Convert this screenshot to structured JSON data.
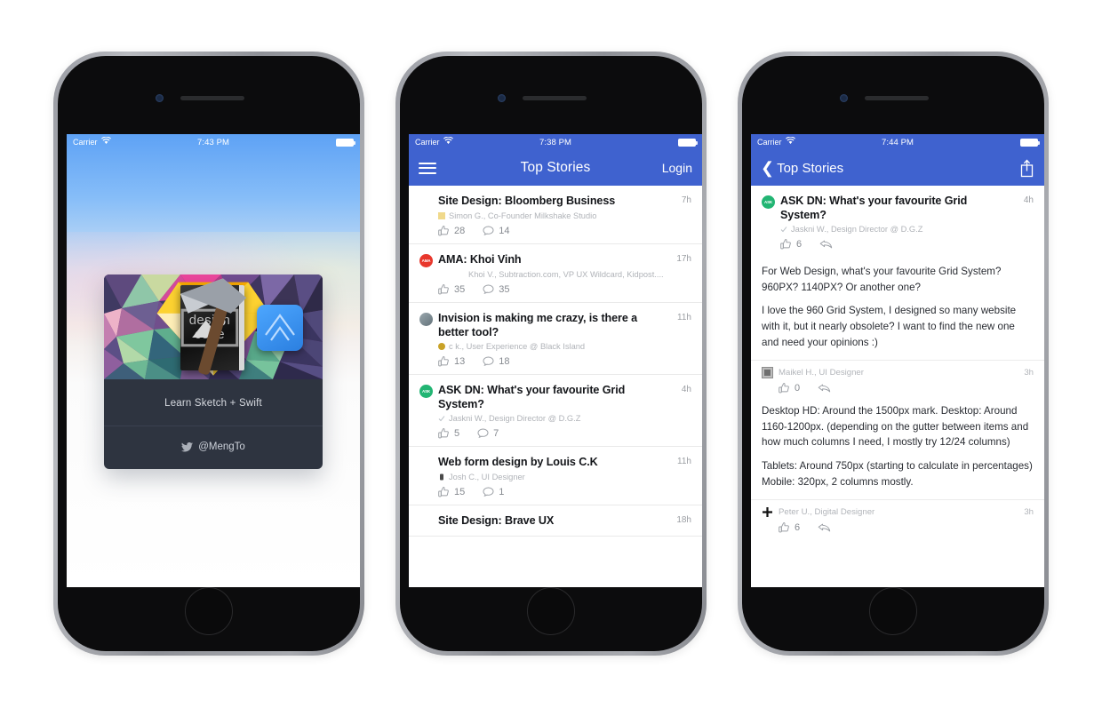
{
  "phones": [
    {
      "name": "promo-screen",
      "status_bar": {
        "carrier": "Carrier",
        "time": "7:43 PM",
        "wifi_icon": "wifi-icon",
        "battery_icon": "battery-full-icon"
      },
      "card": {
        "image_alt": "design-code-book-art",
        "book_line1": "design",
        "book_line2": "code",
        "title": "Learn Sketch + Swift",
        "handle": "@MengTo",
        "twitter_icon": "twitter-icon"
      }
    },
    {
      "name": "top-stories-screen",
      "status_bar": {
        "carrier": "Carrier",
        "time": "7:38 PM",
        "wifi_icon": "wifi-icon",
        "battery_icon": "battery-full-icon"
      },
      "navbar": {
        "menu_icon": "hamburger-menu-icon",
        "title": "Top Stories",
        "action": "Login",
        "accent": "#3f62cf"
      },
      "stories": [
        {
          "avatar": "none",
          "avatar_color": "transparent",
          "title": "Site Design: Bloomberg Business",
          "age": "7h",
          "author": "Simon G., Co-Founder Milkshake Studio",
          "badge_color": "#f0d98b",
          "upvotes": "28",
          "comments": "14"
        },
        {
          "avatar": "AMA",
          "avatar_color": "#e8372c",
          "title": "AMA: Khoi Vinh",
          "age": "17h",
          "author": "Khoi V., Subtraction.com, VP UX Wildcard, Kidpost....",
          "badge_color": "transparent",
          "upvotes": "35",
          "comments": "35",
          "meta_indent": true
        },
        {
          "avatar": "globe",
          "avatar_color": "#7e8a91",
          "title": "Invision is making me crazy, is there a better tool?",
          "age": "11h",
          "author": "c k., User Experience @ Black Island",
          "badge_color": "#c9a227",
          "upvotes": "13",
          "comments": "18"
        },
        {
          "avatar": "ASK",
          "avatar_color": "#22b573",
          "title": "ASK DN: What's your favourite Grid System?",
          "age": "4h",
          "author": "Jaskni W., Design Director @ D.G.Z",
          "badge_color": "#b8bec4",
          "upvotes": "5",
          "comments": "7"
        },
        {
          "avatar": "none",
          "avatar_color": "transparent",
          "title": "Web form design by Louis C.K",
          "age": "11h",
          "author": "Josh C., UI Designer",
          "badge_color": "#4a4a4a",
          "upvotes": "15",
          "comments": "1"
        },
        {
          "avatar": "none",
          "avatar_color": "transparent",
          "title": "Site Design: Brave UX",
          "age": "18h",
          "author": "",
          "badge_color": "transparent",
          "upvotes": "",
          "comments": ""
        }
      ]
    },
    {
      "name": "story-detail-screen",
      "status_bar": {
        "carrier": "Carrier",
        "time": "7:44 PM",
        "wifi_icon": "wifi-icon",
        "battery_icon": "battery-full-icon"
      },
      "navbar": {
        "back_icon": "chevron-left-icon",
        "back_label": "Top Stories",
        "share_icon": "share-icon",
        "accent": "#3f62cf"
      },
      "post": {
        "avatar": "ASK",
        "avatar_color": "#22b573",
        "title": "ASK DN: What's your favourite Grid System?",
        "age": "4h",
        "author": "Jaskni W., Design Director @ D.G.Z",
        "upvotes": "6",
        "reply_icon": "reply-icon",
        "paragraphs": [
          "For Web Design, what's your favourite Grid System? 960PX? 1140PX? Or another one?",
          "I love the 960 Grid System, I designed so many website with it, but it nearly obsolete? I want to find the new one and need your opinions :)"
        ]
      },
      "comments": [
        {
          "avatar_icon": "square-avatar-icon",
          "name": "Maikel H., UI Designer",
          "age": "3h",
          "upvotes": "0",
          "reply_icon": "reply-icon",
          "paragraphs": [
            "Desktop HD: Around the 1500px mark. Desktop: Around 1160-1200px. (depending on the gutter between items and how much columns I need, I mostly try 12/24 columns)",
            "Tablets: Around 750px (starting to calculate in percentages) Mobile: 320px, 2 columns mostly."
          ]
        },
        {
          "avatar_icon": "plus-avatar-icon",
          "name": "Peter U., Digital Designer",
          "age": "3h",
          "upvotes": "6",
          "reply_icon": "reply-icon",
          "paragraphs": []
        }
      ]
    }
  ]
}
